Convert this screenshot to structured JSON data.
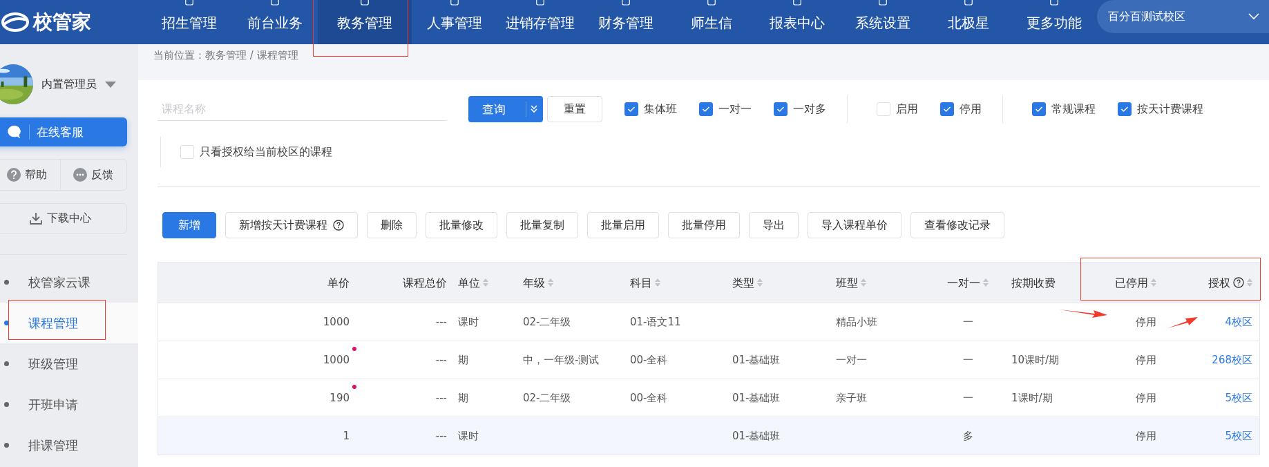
{
  "logo": {
    "text": "校管家"
  },
  "nav": [
    {
      "label": "招生管理",
      "selected": false
    },
    {
      "label": "前台业务",
      "selected": false
    },
    {
      "label": "教务管理",
      "selected": true
    },
    {
      "label": "人事管理",
      "selected": false
    },
    {
      "label": "进销存管理",
      "selected": false
    },
    {
      "label": "财务管理",
      "selected": false
    },
    {
      "label": "师生信",
      "selected": false
    },
    {
      "label": "报表中心",
      "selected": false
    },
    {
      "label": "系统设置",
      "selected": false
    },
    {
      "label": "北极星",
      "selected": false
    },
    {
      "label": "更多功能",
      "selected": false
    }
  ],
  "campus_select": {
    "value": "百分百测试校区"
  },
  "user": {
    "name": "内置管理员"
  },
  "service_button": "在线客服",
  "help_buttons": [
    "帮助",
    "反馈"
  ],
  "download_button": "下载中心",
  "sidebar_menu": [
    {
      "label": "校管家云课",
      "selected": false
    },
    {
      "label": "课程管理",
      "selected": true
    },
    {
      "label": "班级管理",
      "selected": false
    },
    {
      "label": "开班申请",
      "selected": false
    },
    {
      "label": "排课管理",
      "selected": false
    }
  ],
  "breadcrumb": "当前位置：教务管理 / 课程管理",
  "search": {
    "placeholder": "课程名称"
  },
  "query_button": "查询",
  "reset_button": "重置",
  "filter_groups": [
    [
      {
        "label": "集体班",
        "checked": true
      },
      {
        "label": "一对一",
        "checked": true
      },
      {
        "label": "一对多",
        "checked": true
      }
    ],
    [
      {
        "label": "启用",
        "checked": false
      },
      {
        "label": "停用",
        "checked": true
      }
    ],
    [
      {
        "label": "常规课程",
        "checked": true
      },
      {
        "label": "按天计费课程",
        "checked": true
      }
    ]
  ],
  "campus_filter": {
    "label": "只看授权给当前校区的课程",
    "checked": false
  },
  "actions": [
    {
      "label": "新增",
      "primary": true,
      "help": false
    },
    {
      "label": "新增按天计费课程",
      "primary": false,
      "help": true
    },
    {
      "label": "删除",
      "primary": false,
      "help": false
    },
    {
      "label": "批量修改",
      "primary": false,
      "help": false
    },
    {
      "label": "批量复制",
      "primary": false,
      "help": false
    },
    {
      "label": "批量启用",
      "primary": false,
      "help": false
    },
    {
      "label": "批量停用",
      "primary": false,
      "help": false
    },
    {
      "label": "导出",
      "primary": false,
      "help": false
    },
    {
      "label": "导入课程单价",
      "primary": false,
      "help": false
    },
    {
      "label": "查看修改记录",
      "primary": false,
      "help": false
    }
  ],
  "table": {
    "columns": [
      {
        "label": "单价",
        "sortable": false,
        "help": false
      },
      {
        "label": "课程总价",
        "sortable": false,
        "help": false
      },
      {
        "label": "单位",
        "sortable": true,
        "help": false
      },
      {
        "label": "年级",
        "sortable": true,
        "help": false
      },
      {
        "label": "科目",
        "sortable": true,
        "help": false
      },
      {
        "label": "类型",
        "sortable": true,
        "help": false
      },
      {
        "label": "班型",
        "sortable": true,
        "help": false
      },
      {
        "label": "一对一",
        "sortable": true,
        "help": false
      },
      {
        "label": "按期收费",
        "sortable": false,
        "help": false
      },
      {
        "label": "已停用",
        "sortable": true,
        "help": false
      },
      {
        "label": "授权",
        "sortable": true,
        "help": true
      }
    ],
    "rows": [
      {
        "marked": false,
        "highlighted": false,
        "cells": [
          "1000",
          "---",
          "课时",
          "02-二年级",
          "01-语文11",
          "",
          "精品小班",
          "一",
          "",
          "停用",
          "4校区"
        ]
      },
      {
        "marked": true,
        "highlighted": false,
        "cells": [
          "1000",
          "---",
          "期",
          "中，一年级-测试",
          "00-全科",
          "01-基础班",
          "一对一",
          "一",
          "10课时/期",
          "停用",
          "268校区"
        ]
      },
      {
        "marked": true,
        "highlighted": false,
        "cells": [
          "190",
          "---",
          "期",
          "02-二年级",
          "00-全科",
          "01-基础班",
          "亲子班",
          "一",
          "1课时/期",
          "停用",
          "5校区"
        ]
      },
      {
        "marked": false,
        "highlighted": true,
        "cells": [
          "1",
          "---",
          "课时",
          "",
          "",
          "01-基础班",
          "",
          "多",
          "",
          "停用",
          "5校区"
        ]
      }
    ]
  }
}
